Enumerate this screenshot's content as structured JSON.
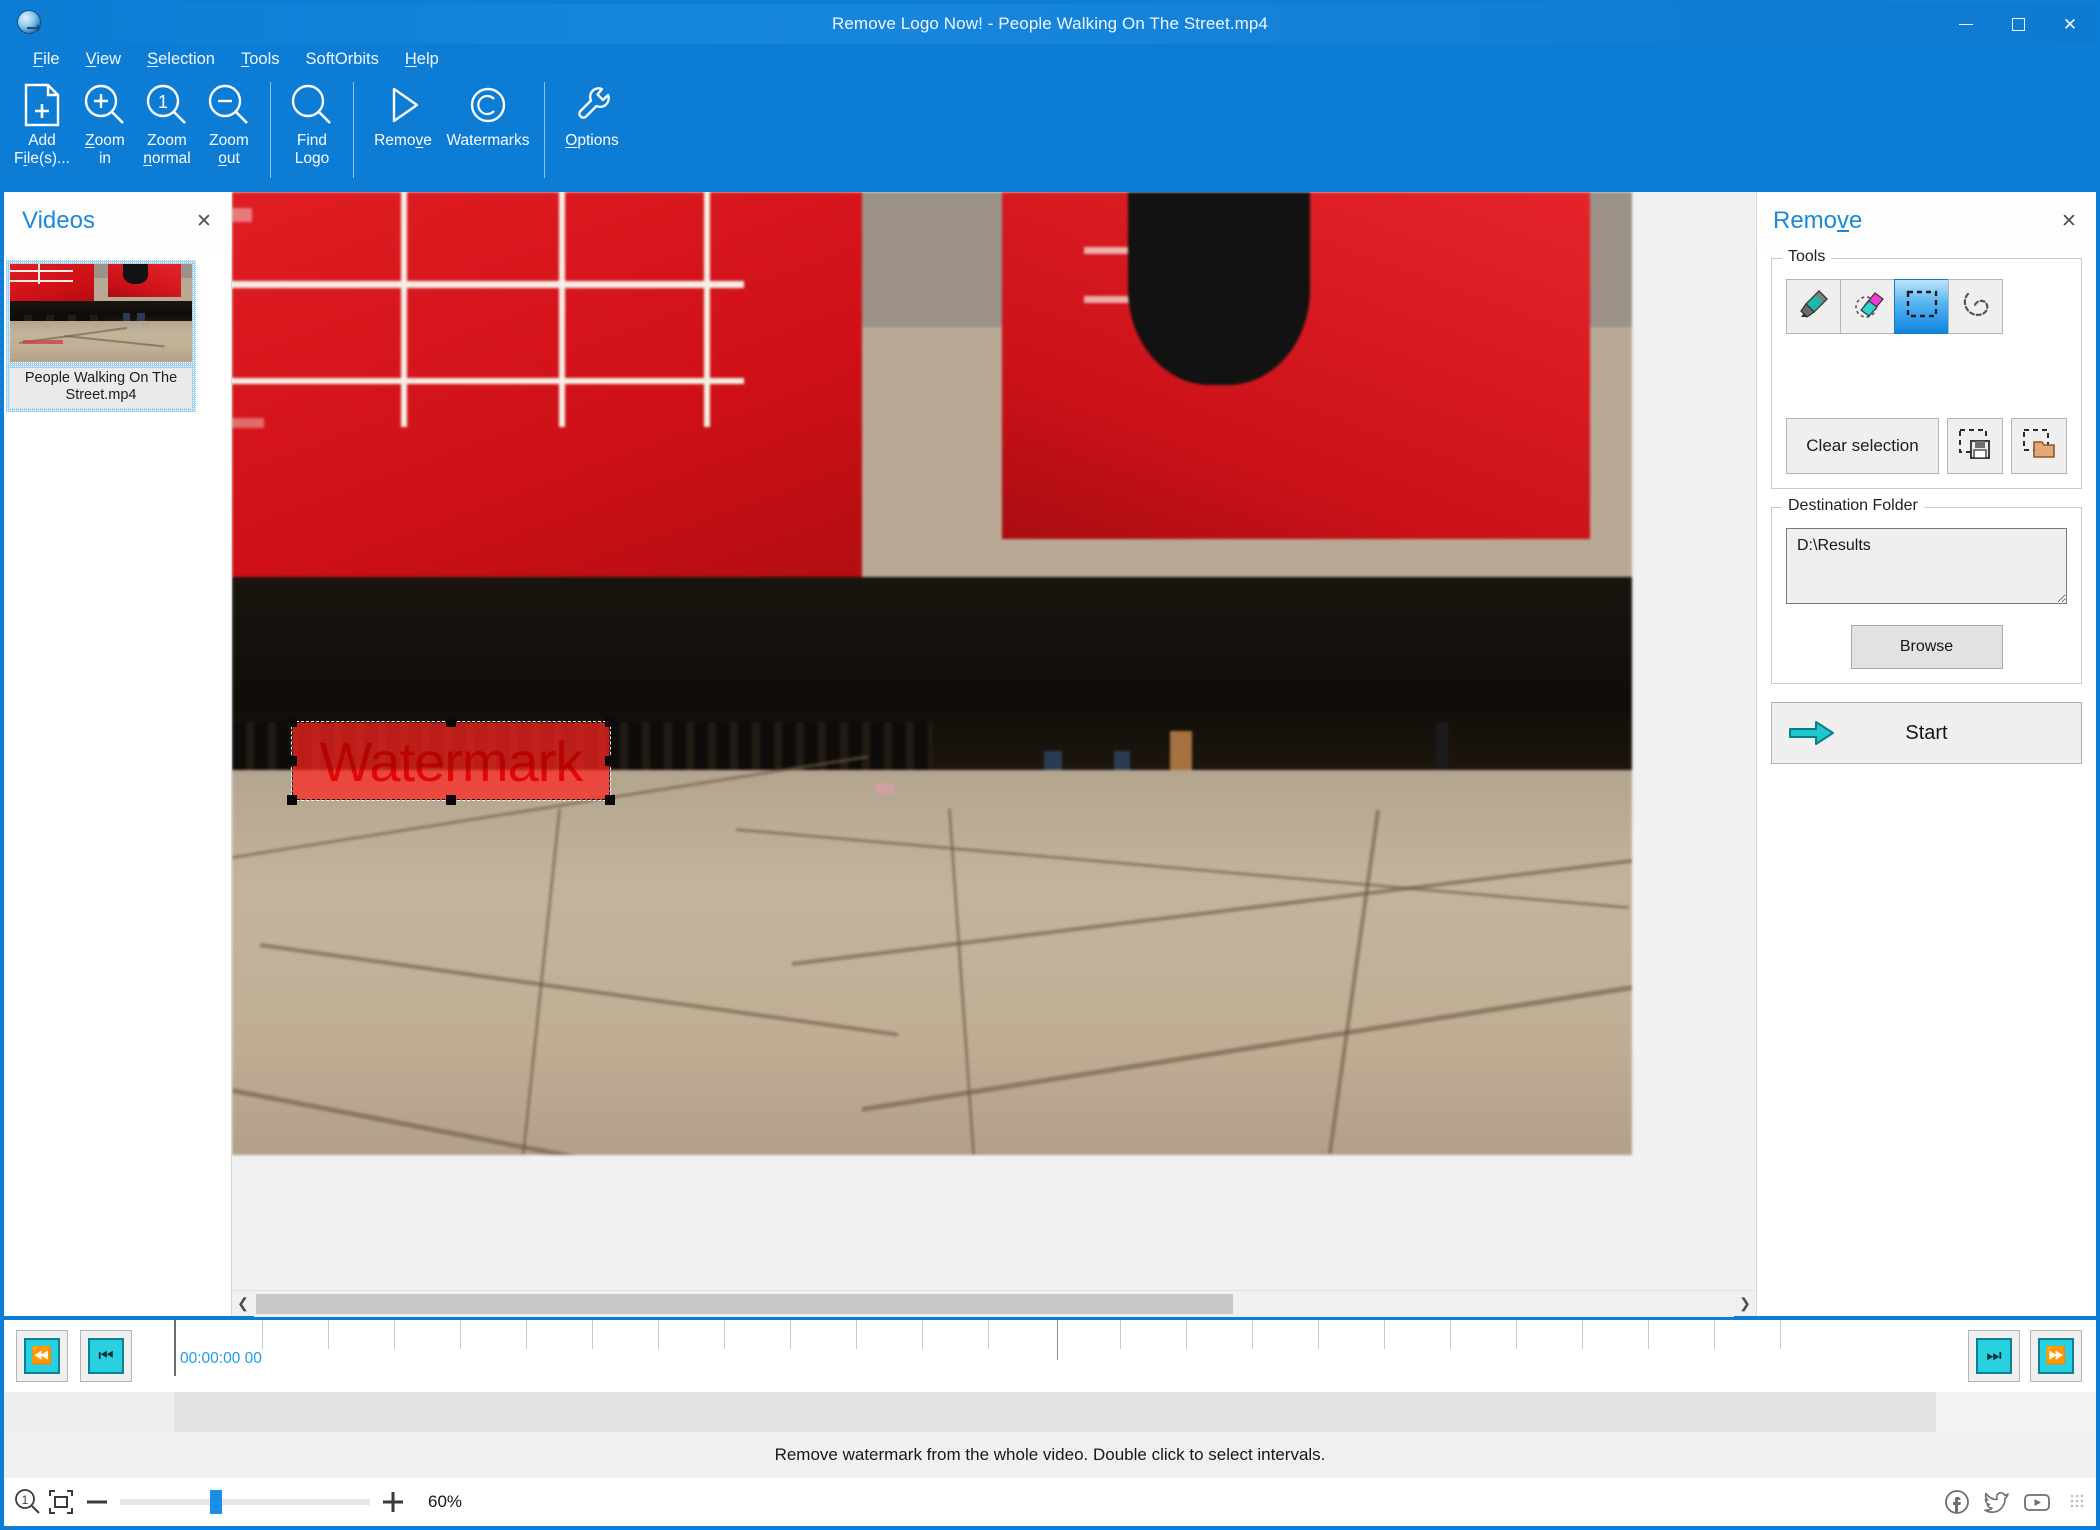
{
  "window": {
    "title": "Remove Logo Now! - People Walking On The Street.mp4",
    "minimize_label": "Minimize",
    "maximize_label": "Maximize",
    "close_label": "Close",
    "accent_color": "#0d7cd4",
    "logo_icon": "app-globe-arrow-icon"
  },
  "menubar": {
    "items": [
      {
        "label": "File",
        "mnemonic": "F"
      },
      {
        "label": "View",
        "mnemonic": "V"
      },
      {
        "label": "Selection",
        "mnemonic": "S"
      },
      {
        "label": "Tools",
        "mnemonic": "T"
      },
      {
        "label": "SoftOrbits",
        "mnemonic": ""
      },
      {
        "label": "Help",
        "mnemonic": "H"
      }
    ]
  },
  "toolbar": {
    "buttons": [
      {
        "label": "Add\nFile(s)...",
        "icon": "add-file-icon",
        "name": "add-files"
      },
      {
        "label": "Zoom\nin",
        "icon": "zoom-in-icon",
        "name": "zoom-in"
      },
      {
        "label": "Zoom\nnormal",
        "icon": "zoom-normal-icon",
        "name": "zoom-normal"
      },
      {
        "label": "Zoom\nout",
        "icon": "zoom-out-icon",
        "name": "zoom-out"
      },
      {
        "label": "Find\nLogo",
        "icon": "find-logo-icon",
        "name": "find-logo"
      }
    ],
    "remove_label": "Remove",
    "remove_icon": "play-triangle-icon",
    "watermarks_label": "Watermarks",
    "watermarks_icon": "copyright-icon",
    "options_label": "Options",
    "options_icon": "wrench-icon"
  },
  "videos_panel": {
    "title": "Videos",
    "close_icon": "close-icon",
    "items": [
      {
        "caption": "People Walking On The Street.mp4",
        "selected": true
      }
    ]
  },
  "viewer": {
    "selection": {
      "watermark_text": "Watermark",
      "highlight_color": "#ff241e"
    },
    "scroll_left_icon": "chevron-left-icon",
    "scroll_right_icon": "chevron-right-icon"
  },
  "remove_panel": {
    "title": "Remove",
    "title_mnemonic": "v",
    "close_icon": "close-icon",
    "tools_group_label": "Tools",
    "tools": [
      {
        "name": "marker-tool",
        "icon": "marker-pen-icon",
        "active": false
      },
      {
        "name": "eraser-tool",
        "icon": "eraser-icon",
        "active": false
      },
      {
        "name": "rectangle-select-tool",
        "icon": "rectangle-select-icon",
        "active": true
      },
      {
        "name": "lasso-select-tool",
        "icon": "lasso-select-icon",
        "active": false
      }
    ],
    "clear_selection_label": "Clear selection",
    "save_selection_icon": "save-selection-icon",
    "load_selection_icon": "load-selection-icon",
    "destination_group_label": "Destination Folder",
    "destination_value": "D:\\Results",
    "browse_label": "Browse",
    "start_label": "Start",
    "start_icon": "arrow-right-icon",
    "start_arrow_color": "#15b6c4"
  },
  "timeline": {
    "skip_start_icon": "skip-to-start-icon",
    "step_back_icon": "step-back-icon",
    "step_forward_icon": "step-forward-icon",
    "skip_end_icon": "skip-to-end-icon",
    "timecode": "00:00:00 00",
    "timecode_color": "#1f9bea",
    "status_text": "Remove watermark from the whole video. Double click to select intervals."
  },
  "footer": {
    "zoom_normal_icon": "zoom-one-icon",
    "fit_icon": "fit-to-window-icon",
    "minus_icon": "minus-icon",
    "plus_icon": "plus-icon",
    "zoom_value": "60%",
    "social": [
      {
        "name": "facebook-icon",
        "glyph": "f"
      },
      {
        "name": "twitter-icon",
        "glyph": "t"
      },
      {
        "name": "youtube-icon",
        "glyph": "y"
      }
    ],
    "resize_grip_icon": "resize-grip-icon"
  }
}
